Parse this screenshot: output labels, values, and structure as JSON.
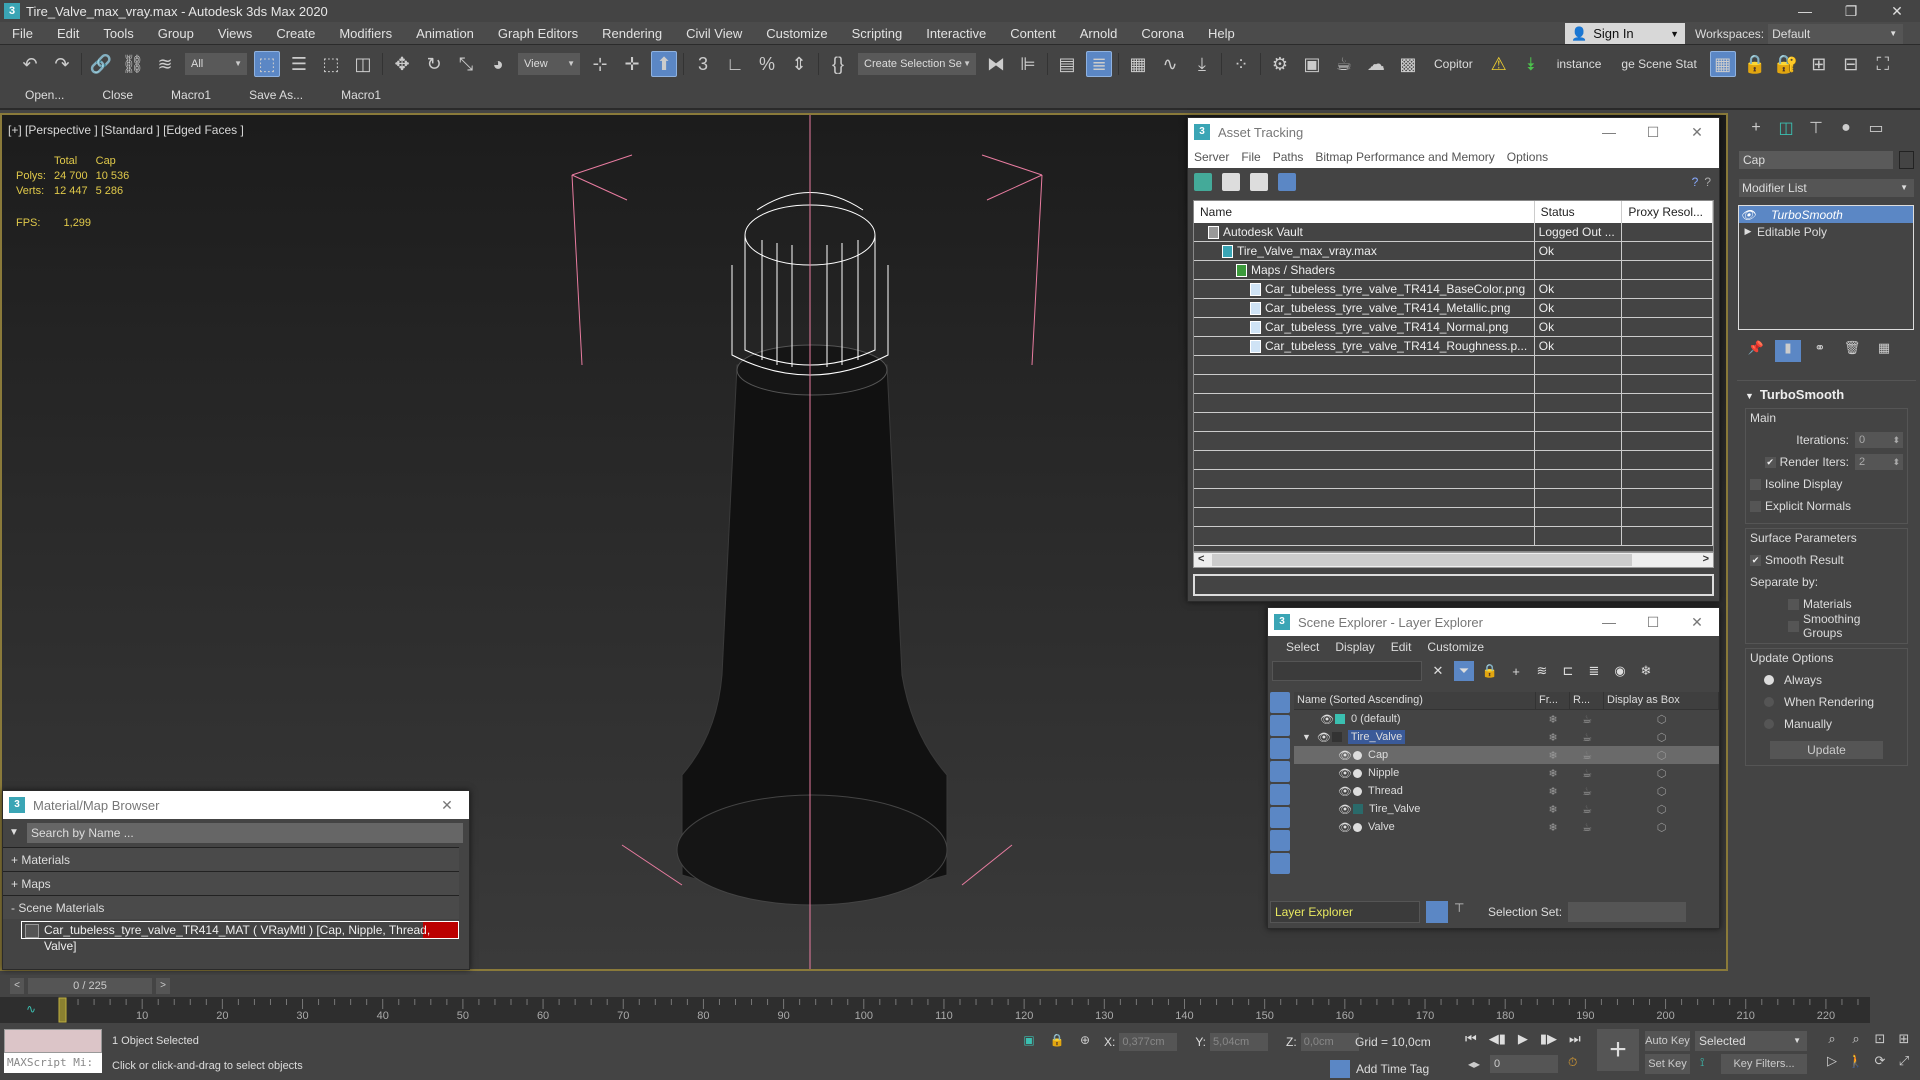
{
  "window": {
    "title": "Tire_Valve_max_vray.max - Autodesk 3ds Max 2020",
    "app_icon": "3"
  },
  "menu": [
    "File",
    "Edit",
    "Tools",
    "Group",
    "Views",
    "Create",
    "Modifiers",
    "Animation",
    "Graph Editors",
    "Rendering",
    "Civil View",
    "Customize",
    "Scripting",
    "Interactive",
    "Content",
    "Arnold",
    "Corona",
    "Help"
  ],
  "account": {
    "sign_in": "Sign In",
    "workspaces_label": "Workspaces:",
    "workspace": "Default"
  },
  "toolbar": {
    "selection_filter": "All",
    "ref_coord": "View",
    "named_selection": "Create Selection Se",
    "text_buttons": [
      "Copitor",
      "instance",
      "ge Scene Stat"
    ]
  },
  "macrobar": [
    "Open...",
    "Close",
    "Macro1",
    "Save As...",
    "Macro1"
  ],
  "viewport": {
    "label": "[+] [Perspective ] [Standard ] [Edged Faces ]",
    "stats": {
      "headers": [
        "",
        "Total",
        "Cap"
      ],
      "rows": [
        [
          "Polys:",
          "24 700",
          "10 536"
        ],
        [
          "Verts:",
          "12 447",
          "5 286"
        ]
      ]
    },
    "fps_label": "FPS:",
    "fps": "1,299"
  },
  "asset_tracking": {
    "title": "Asset Tracking",
    "menu": [
      "Server",
      "File",
      "Paths",
      "Bitmap Performance and Memory",
      "Options"
    ],
    "columns": [
      "Name",
      "Status",
      "Proxy Resol..."
    ],
    "rows": [
      {
        "name": "Autodesk Vault",
        "status": "Logged Out ...",
        "indent": 1
      },
      {
        "name": "Tire_Valve_max_vray.max",
        "status": "Ok",
        "indent": 2
      },
      {
        "name": "Maps / Shaders",
        "status": "",
        "indent": 3
      },
      {
        "name": "Car_tubeless_tyre_valve_TR414_BaseColor.png",
        "status": "Ok",
        "indent": 4
      },
      {
        "name": "Car_tubeless_tyre_valve_TR414_Metallic.png",
        "status": "Ok",
        "indent": 4
      },
      {
        "name": "Car_tubeless_tyre_valve_TR414_Normal.png",
        "status": "Ok",
        "indent": 4
      },
      {
        "name": "Car_tubeless_tyre_valve_TR414_Roughness.p...",
        "status": "Ok",
        "indent": 4
      }
    ]
  },
  "scene_explorer": {
    "title": "Scene Explorer - Layer Explorer",
    "menu": [
      "Select",
      "Display",
      "Edit",
      "Customize"
    ],
    "columns": [
      "Name (Sorted Ascending)",
      "Fr...",
      "R...",
      "Display as Box"
    ],
    "rows": [
      {
        "name": "0 (default)",
        "type": "layer",
        "level": 0
      },
      {
        "name": "Tire_Valve",
        "type": "layer",
        "level": 0,
        "highlighted": true
      },
      {
        "name": "Cap",
        "type": "object",
        "level": 1,
        "selected": true
      },
      {
        "name": "Nipple",
        "type": "object",
        "level": 1
      },
      {
        "name": "Thread",
        "type": "object",
        "level": 1
      },
      {
        "name": "Tire_Valve",
        "type": "group",
        "level": 1
      },
      {
        "name": "Valve",
        "type": "object",
        "level": 1
      }
    ],
    "explorer_mode": "Layer Explorer",
    "selection_set_label": "Selection Set:"
  },
  "command_panel": {
    "object_name": "Cap",
    "modifier_list": "Modifier List",
    "stack": [
      "TurboSmooth",
      "Editable Poly"
    ],
    "rollout_title": "TurboSmooth",
    "main_group": "Main",
    "iterations_label": "Iterations:",
    "iterations": "0",
    "render_iters_label": "Render Iters:",
    "render_iters": "2",
    "render_iters_checked": true,
    "isoline_display": "Isoline Display",
    "explicit_normals": "Explicit Normals",
    "surface_group": "Surface Parameters",
    "smooth_result": "Smooth Result",
    "separate_by": "Separate by:",
    "materials": "Materials",
    "smoothing_groups": "Smoothing Groups",
    "update_group": "Update Options",
    "update_options": [
      "Always",
      "When Rendering",
      "Manually"
    ],
    "update_selected": "Always",
    "update_button": "Update"
  },
  "material_browser": {
    "title": "Material/Map Browser",
    "search_placeholder": "Search by Name ...",
    "categories": [
      "+ Materials",
      "+ Maps",
      "- Scene Materials"
    ],
    "scene_material": "Car_tubeless_tyre_valve_TR414_MAT  ( VRayMtl )  [Cap, Nipple, Thread, Valve]"
  },
  "timeline": {
    "frame_display": "0 / 225",
    "current_frame": 0,
    "total_frames": 225,
    "ticks": [
      0,
      10,
      20,
      30,
      40,
      50,
      60,
      70,
      80,
      90,
      100,
      110,
      120,
      130,
      140,
      150,
      160,
      170,
      180,
      190,
      200,
      210,
      220
    ]
  },
  "status": {
    "maxscript": "MAXScript Mi:",
    "selection": "1 Object Selected",
    "hint": "Click or click-and-drag to select objects",
    "x_label": "X:",
    "x": "0,377cm",
    "y_label": "Y:",
    "y": "5,04cm",
    "z_label": "Z:",
    "z": "0,0cm",
    "grid": "Grid = 10,0cm",
    "add_time_tag": "Add Time Tag",
    "frame": "0",
    "auto_key": "Auto Key",
    "set_key": "Set Key",
    "key_mode": "Selected",
    "key_filters": "Key Filters..."
  }
}
